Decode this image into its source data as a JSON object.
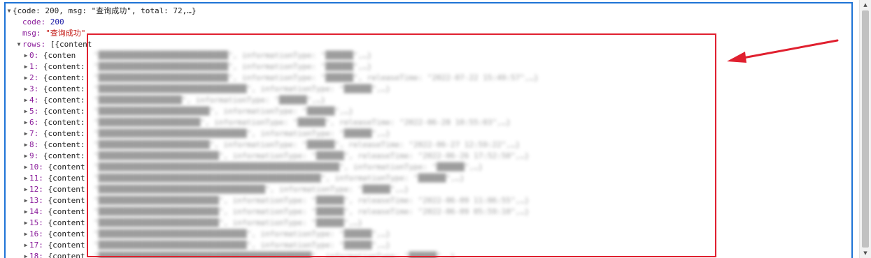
{
  "summary": "{code: 200, msg: \"查询成功\", total: 72,…}",
  "fields": {
    "code_key": "code:",
    "code_value": "200",
    "msg_key": "msg:",
    "msg_value": "\"查询成功\"",
    "rows_key": "rows:",
    "rows_preview": "[{content"
  },
  "rows": [
    {
      "label": "0:",
      "prefix": "{conten"
    },
    {
      "label": "1:",
      "prefix": "{content:"
    },
    {
      "label": "2:",
      "prefix": "{content:"
    },
    {
      "label": "3:",
      "prefix": "{content:"
    },
    {
      "label": "4:",
      "prefix": "{content:"
    },
    {
      "label": "5:",
      "prefix": "{content:"
    },
    {
      "label": "6:",
      "prefix": "{content:"
    },
    {
      "label": "7:",
      "prefix": "{content:"
    },
    {
      "label": "8:",
      "prefix": "{content:"
    },
    {
      "label": "9:",
      "prefix": "{content:"
    },
    {
      "label": "10:",
      "prefix": "{content"
    },
    {
      "label": "11:",
      "prefix": "{content"
    },
    {
      "label": "12:",
      "prefix": "{content"
    },
    {
      "label": "13:",
      "prefix": "{content"
    },
    {
      "label": "14:",
      "prefix": "{content"
    },
    {
      "label": "15:",
      "prefix": "{content"
    },
    {
      "label": "16:",
      "prefix": "{content"
    },
    {
      "label": "17:",
      "prefix": "{content"
    },
    {
      "label": "18:",
      "prefix": "{content"
    }
  ],
  "blurred_text": [
    "\"████████████████████████████\", informationType: \"██████\",…}",
    "\"████████████████████████████\", informationType: \"██████\",…}",
    "\"████████████████████████████\", informationType: \"██████\", releaseTime: \"2022-07-22 15:49:57\",…}",
    "\"████████████████████████████████\", informationType: \"██████\",…}",
    "\"██████████████████\", informationType: \"██████\",…}",
    "\"████████████████████████\", informationType: \"██████\",…}",
    "\"██████████████████████\", informationType: \"██████\", releaseTime: \"2022-06-28 10:55:03\",…}",
    "\"████████████████████████████████\", informationType: \"██████\",…}",
    "\"████████████████████████\", informationType: \"██████\", releaseTime: \"2022-06-27 12:59:22\",…}",
    "\"██████████████████████████\", informationType: \"██████\", releaseTime: \"2022-06-26 17:52:50\",…}",
    "\"████████████████████████████████████████████████████\", informationType: \"██████\",…}",
    "\"████████████████████████████████████████████████\", informationType: \"██████\",…}",
    "\"████████████████████████████████████\", informationType: \"██████\",…}",
    "\"██████████████████████████\", informationType: \"██████\", releaseTime: \"2022-06-09 11:06:55\",…}",
    "\"██████████████████████████\", informationType: \"██████\", releaseTime: \"2022-06-09 05:59:10\",…}",
    "\"██████████████████████████\", informationType: \"██████\",…}",
    "\"████████████████████████████████\", informationType: \"██████\",…}",
    "\"████████████████████████████████\", informationType: \"██████\",…}",
    "\"██████████████████████████████████████████████\", informationType: \"██████\",…}"
  ],
  "colors": {
    "panel_border": "#1e73d6",
    "highlight_box": "#e0202f",
    "arrow": "#e0202f",
    "key_color": "#8b1e9b",
    "number_color": "#1a1aa6",
    "string_color": "#c41a16"
  },
  "icons": {
    "expanded": "triangle-down-icon",
    "collapsed": "triangle-right-icon"
  }
}
